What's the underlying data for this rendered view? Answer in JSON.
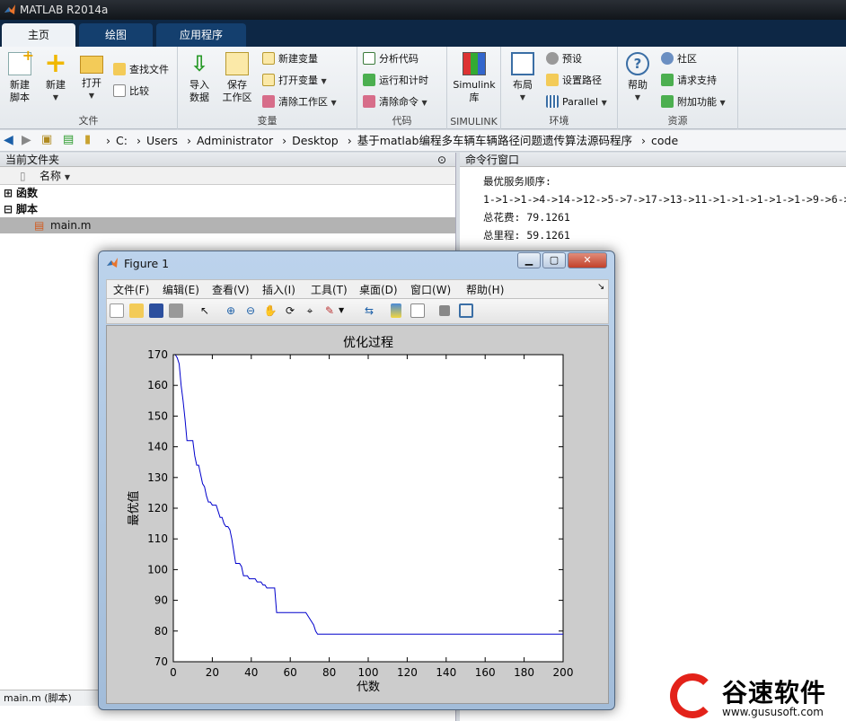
{
  "app": {
    "title": "MATLAB R2014a"
  },
  "tabs": [
    "主页",
    "绘图",
    "应用程序"
  ],
  "ribbon": {
    "file": {
      "new_script": "新建\n脚本",
      "new": "新建",
      "open": "打开",
      "find_files": "查找文件",
      "compare": "比较",
      "label": "文件"
    },
    "variable": {
      "import": "导入\n数据",
      "save_ws": "保存\n工作区",
      "new_var": "新建变量",
      "open_var": "打开变量",
      "clear_ws": "清除工作区",
      "label": "变量"
    },
    "code": {
      "analyze": "分析代码",
      "run_time": "运行和计时",
      "clear_cmd": "清除命令",
      "label": "代码"
    },
    "simulink": {
      "lib": "Simulink\n库",
      "label": "SIMULINK"
    },
    "env": {
      "layout": "布局",
      "prefs": "预设",
      "set_path": "设置路径",
      "parallel": "Parallel",
      "label": "环境"
    },
    "resources": {
      "help": "帮助",
      "community": "社区",
      "support": "请求支持",
      "addons": "附加功能",
      "label": "资源"
    }
  },
  "address": {
    "crumbs": [
      "C:",
      "Users",
      "Administrator",
      "Desktop",
      "基于matlab编程多车辆车辆路径问题遗传算法源码程序",
      "code"
    ]
  },
  "current_folder": {
    "title": "当前文件夹",
    "col_name": "名称",
    "groups": [
      "函数",
      "脚本"
    ],
    "file": "main.m",
    "status": "main.m (脚本)"
  },
  "command_window": {
    "title": "命令行窗口",
    "lines": [
      "最优服务顺序:",
      "1->1->1->4->14->12->5->7->17->13->11->1->1->1->1->1->9->6->",
      "总花费: 79.1261",
      "总里程: 59.1261"
    ]
  },
  "figure": {
    "title": "Figure 1",
    "menus": [
      "文件(F)",
      "编辑(E)",
      "查看(V)",
      "插入(I)",
      "工具(T)",
      "桌面(D)",
      "窗口(W)",
      "帮助(H)"
    ]
  },
  "chart_data": {
    "type": "line",
    "title": "优化过程",
    "xlabel": "代数",
    "ylabel": "最优值",
    "xlim": [
      0,
      200
    ],
    "ylim": [
      70,
      170
    ],
    "xticks": [
      0,
      20,
      40,
      60,
      80,
      100,
      120,
      140,
      160,
      180,
      200
    ],
    "yticks": [
      70,
      80,
      90,
      100,
      110,
      120,
      130,
      140,
      150,
      160,
      170
    ],
    "color": "#0000cc",
    "x": [
      0,
      1,
      2,
      3,
      4,
      5,
      6,
      7,
      8,
      9,
      10,
      11,
      12,
      13,
      14,
      15,
      16,
      17,
      18,
      19,
      20,
      21,
      22,
      23,
      24,
      25,
      26,
      27,
      28,
      29,
      30,
      31,
      32,
      33,
      34,
      35,
      36,
      37,
      38,
      39,
      40,
      41,
      42,
      43,
      44,
      45,
      46,
      47,
      48,
      49,
      50,
      51,
      52,
      53,
      54,
      55,
      56,
      57,
      58,
      60,
      62,
      64,
      66,
      68,
      70,
      72,
      73,
      74,
      76,
      80,
      85,
      90,
      100,
      120,
      140,
      160,
      180,
      200
    ],
    "y": [
      170,
      170,
      169,
      167,
      160,
      155,
      149,
      142,
      142,
      142,
      142,
      137,
      134,
      134,
      131,
      128,
      127,
      124,
      122,
      122,
      121,
      121,
      121,
      119,
      117,
      117,
      115,
      114,
      114,
      113,
      110,
      106,
      102,
      102,
      102,
      101,
      98,
      98,
      98,
      97,
      97,
      97,
      97,
      96,
      96,
      96,
      95,
      95,
      94,
      94,
      94,
      94,
      94,
      86,
      86,
      86,
      86,
      86,
      86,
      86,
      86,
      86,
      86,
      86,
      84,
      82,
      80,
      79,
      79,
      79,
      79,
      79,
      79,
      79,
      79,
      79,
      79,
      79
    ]
  },
  "watermark": {
    "text": "谷速软件",
    "url": "www.gususoft.com"
  }
}
